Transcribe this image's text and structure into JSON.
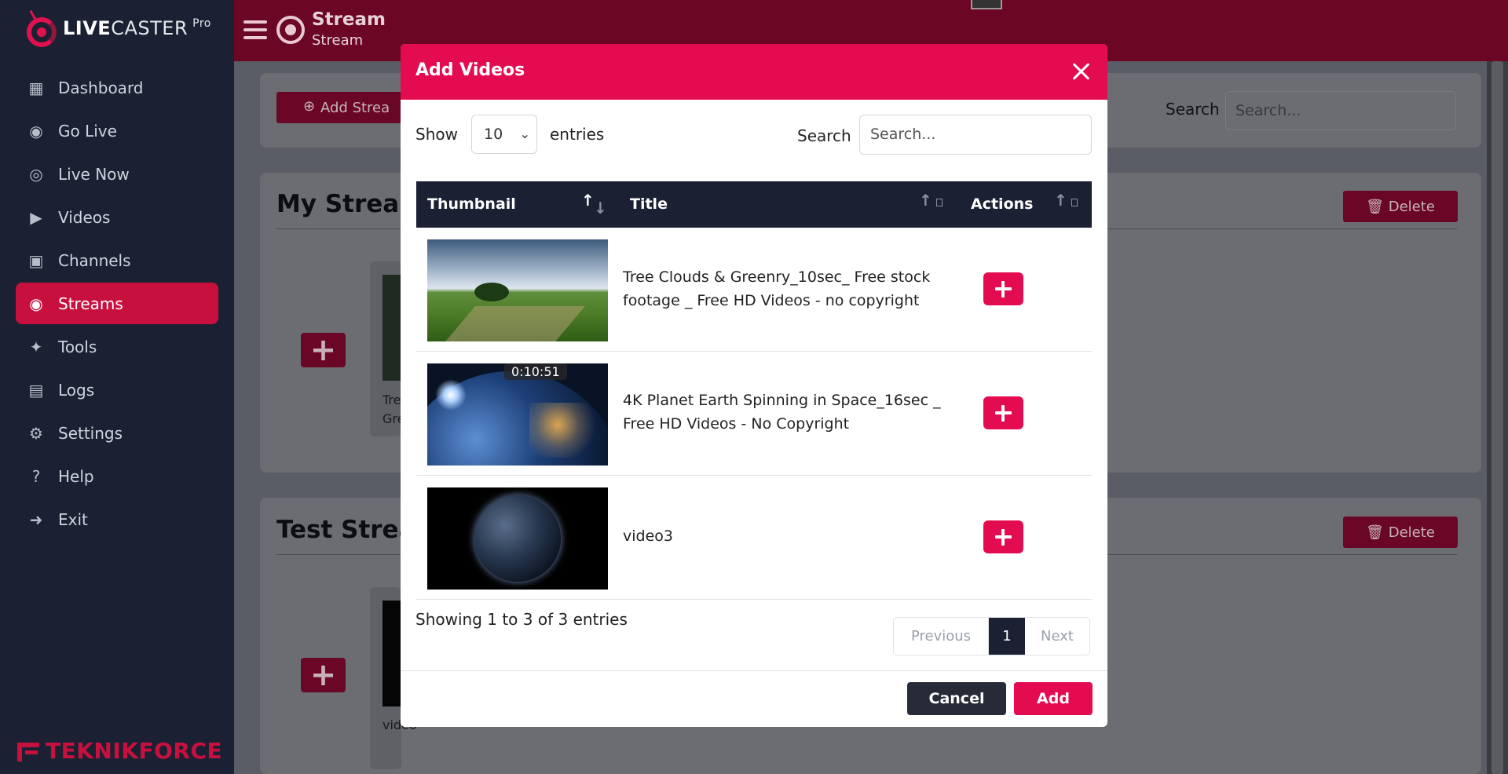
{
  "brand": {
    "name_bold": "LIVE",
    "name_thin": "CASTER",
    "edition": "Pro"
  },
  "sidebar": {
    "items": [
      {
        "label": "Dashboard",
        "icon": "dashboard-icon"
      },
      {
        "label": "Go Live",
        "icon": "go-live-icon"
      },
      {
        "label": "Live Now",
        "icon": "broadcast-icon"
      },
      {
        "label": "Videos",
        "icon": "video-icon"
      },
      {
        "label": "Channels",
        "icon": "tv-icon"
      },
      {
        "label": "Streams",
        "icon": "stream-icon",
        "active": true
      },
      {
        "label": "Tools",
        "icon": "tools-icon"
      },
      {
        "label": "Logs",
        "icon": "logs-icon"
      },
      {
        "label": "Settings",
        "icon": "gear-icon"
      },
      {
        "label": "Help",
        "icon": "help-icon"
      },
      {
        "label": "Exit",
        "icon": "exit-icon"
      }
    ]
  },
  "footer_brand": {
    "part1": "TEKNIK",
    "part2": "FORCE"
  },
  "header": {
    "title": "Stream",
    "subtitle": "Stream"
  },
  "background": {
    "add_stream_label": "Add Strea",
    "search_label": "Search",
    "search_placeholder": "Search...",
    "section1_title": "My Stream",
    "section2_title": "Test Strea",
    "delete_label": "Delete",
    "tile1_text": "Tre\nGre",
    "tile2_text": "video"
  },
  "modal": {
    "title": "Add Videos",
    "show_label": "Show",
    "entries_value": "10",
    "entries_label": "entries",
    "search_label": "Search",
    "search_placeholder": "Search...",
    "columns": [
      "Thumbnail",
      "Title",
      "Actions"
    ],
    "rows": [
      {
        "title": "Tree Clouds & Greenry_10sec_ Free stock footage _ Free HD Videos - no copyright",
        "duration": ""
      },
      {
        "title": "4K Planet Earth Spinning in Space_16sec _ Free HD Videos - No Copyright",
        "duration": "0:10:51"
      },
      {
        "title": "video3",
        "duration": ""
      }
    ],
    "info": "Showing 1 to 3 of 3 entries",
    "pagination": {
      "previous": "Previous",
      "current": "1",
      "next": "Next"
    },
    "cancel_label": "Cancel",
    "add_label": "Add"
  },
  "colors": {
    "accent": "#e40c50",
    "sidebar": "#1b2133",
    "header": "#6b0624"
  }
}
